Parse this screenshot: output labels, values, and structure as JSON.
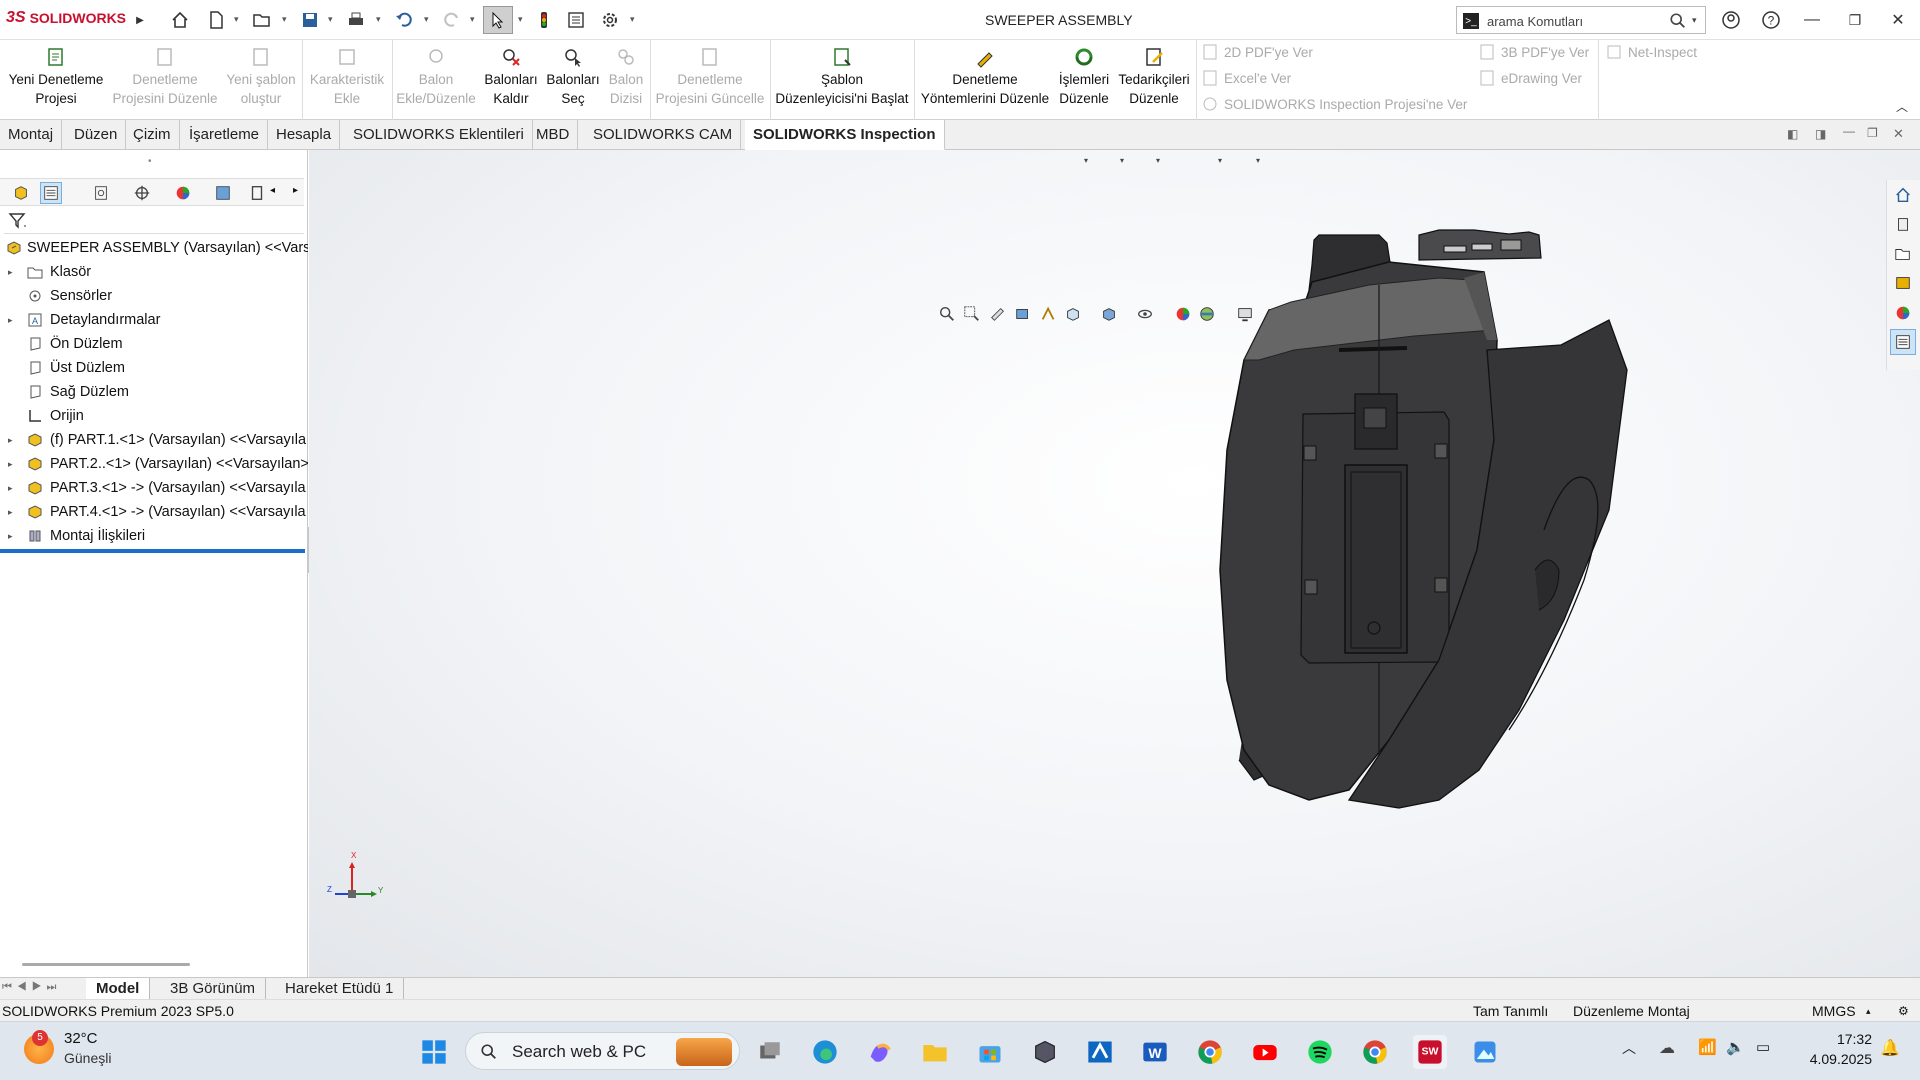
{
  "app": {
    "logo_text": "SOLIDWORKS",
    "window_title": "SWEEPER ASSEMBLY"
  },
  "search": {
    "placeholder": "arama Komutları"
  },
  "ribbon": {
    "large_buttons": [
      {
        "label": "Yeni Denetleme Projesi",
        "line1": "Yeni Denetleme",
        "line2": "Projesi",
        "enabled": true
      },
      {
        "label": "Denetleme Projesini Düzenle",
        "line1": "Denetleme",
        "line2": "Projesini Düzenle",
        "enabled": false
      },
      {
        "label": "Yeni şablon oluştur",
        "line1": "Yeni şablon",
        "line2": "oluştur",
        "enabled": false
      },
      {
        "label": "Karakteristik Ekle",
        "line1": "Karakteristik",
        "line2": "Ekle",
        "enabled": false
      },
      {
        "label": "Balon Ekle/Düzenle",
        "line1": "Balon",
        "line2": "Ekle/Düzenle",
        "enabled": false
      },
      {
        "label": "Balonları Kaldır",
        "line1": "Balonları",
        "line2": "Kaldır",
        "enabled": true
      },
      {
        "label": "Balonları Seç",
        "line1": "Balonları",
        "line2": "Seç",
        "enabled": true
      },
      {
        "label": "Balon Dizisi",
        "line1": "Balon",
        "line2": "Dizisi",
        "enabled": false
      },
      {
        "label": "Denetleme Projesini Güncelle",
        "line1": "Denetleme",
        "line2": "Projesini Güncelle",
        "enabled": false
      },
      {
        "label": "Şablon Düzenleyicisi'ni Başlat",
        "line1": "Şablon",
        "line2": "Düzenleyicisi'ni Başlat",
        "enabled": true
      },
      {
        "label": "Denetleme Yöntemlerini Düzenle",
        "line1": "Denetleme",
        "line2": "Yöntemlerini Düzenle",
        "enabled": true
      },
      {
        "label": "İşlemleri Düzenle",
        "line1": "İşlemleri",
        "line2": "Düzenle",
        "enabled": true
      },
      {
        "label": "Tedarikçileri Düzenle",
        "line1": "Tedarikçileri",
        "line2": "Düzenle",
        "enabled": true
      }
    ],
    "small_buttons": [
      {
        "label": "2D PDF'ye Ver",
        "enabled": false
      },
      {
        "label": "Excel'e Ver",
        "enabled": false
      },
      {
        "label": "SOLIDWORKS Inspection Projesi'ne Ver",
        "enabled": false
      },
      {
        "label": "3B PDF'ye Ver",
        "enabled": false
      },
      {
        "label": "eDrawing Ver",
        "enabled": false
      },
      {
        "label": "Net-Inspect",
        "enabled": false
      }
    ]
  },
  "tabs": [
    {
      "label": "Montaj",
      "active": false
    },
    {
      "label": "Düzen",
      "active": false
    },
    {
      "label": "Çizim",
      "active": false
    },
    {
      "label": "İşaretleme",
      "active": false
    },
    {
      "label": "Hesapla",
      "active": false
    },
    {
      "label": "SOLIDWORKS Eklentileri",
      "active": false
    },
    {
      "label": "MBD",
      "active": false
    },
    {
      "label": "SOLIDWORKS CAM",
      "active": false
    },
    {
      "label": "SOLIDWORKS Inspection",
      "active": true
    }
  ],
  "tree": {
    "root": "SWEEPER ASSEMBLY (Varsayılan) <<Varsa",
    "items": [
      {
        "label": "Klasör",
        "expandable": true,
        "icon": "folder-icon"
      },
      {
        "label": "Sensörler",
        "expandable": false,
        "icon": "sensor-icon"
      },
      {
        "label": "Detaylandırmalar",
        "expandable": true,
        "icon": "annotation-icon"
      },
      {
        "label": "Ön Düzlem",
        "expandable": false,
        "icon": "plane-icon"
      },
      {
        "label": "Üst Düzlem",
        "expandable": false,
        "icon": "plane-icon"
      },
      {
        "label": "Sağ Düzlem",
        "expandable": false,
        "icon": "plane-icon"
      },
      {
        "label": "Orijin",
        "expandable": false,
        "icon": "origin-icon"
      },
      {
        "label": "(f) PART.1.<1> (Varsayılan) <<Varsayıla",
        "expandable": true,
        "icon": "part-icon"
      },
      {
        "label": "PART.2..<1> (Varsayılan) <<Varsayılan>",
        "expandable": true,
        "icon": "part-icon"
      },
      {
        "label": "PART.3.<1> -> (Varsayılan) <<Varsayıla",
        "expandable": true,
        "icon": "part-icon"
      },
      {
        "label": "PART.4.<1> -> (Varsayılan) <<Varsayıla",
        "expandable": true,
        "icon": "part-icon"
      },
      {
        "label": "Montaj İlişkileri",
        "expandable": true,
        "icon": "mate-icon"
      }
    ]
  },
  "triad": {
    "x": "X",
    "y": "Y",
    "z": "Z"
  },
  "bottom_tabs": [
    {
      "label": "Model",
      "active": true
    },
    {
      "label": "3B Görünüm",
      "active": false
    },
    {
      "label": "Hareket Etüdü 1",
      "active": false
    }
  ],
  "status": {
    "version": "SOLIDWORKS Premium 2023 SP5.0",
    "definition": "Tam Tanımlı",
    "mode": "Düzenleme Montaj",
    "units": "MMGS"
  },
  "taskbar": {
    "weather_badge": "5",
    "temperature": "32°C",
    "weather_text": "Güneşli",
    "search_text": "Search web & PC",
    "time": "17:32",
    "date": "4.09.2025"
  },
  "colors": {
    "accent": "#0078d4",
    "brand": "#c8102e",
    "model": "#3a3a3c",
    "highlight": "#1a6fc9"
  }
}
